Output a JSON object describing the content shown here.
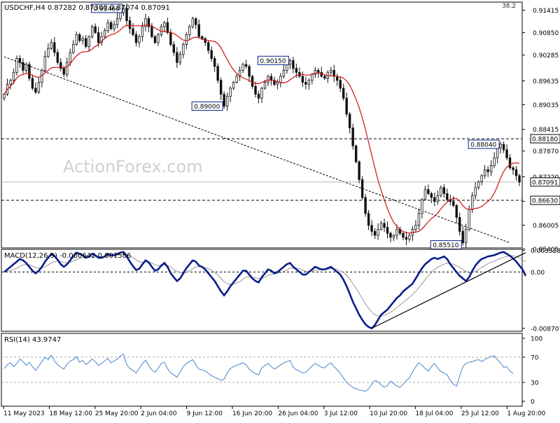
{
  "header": {
    "symbol_line": "USDCHF,H4  0.87282 0.87300 0.87074 0.87091",
    "zoom_value": "38.2"
  },
  "watermark": "ActionForex.com",
  "colors": {
    "candle": "#111111",
    "sma": "#d01010",
    "macd": "#0a1e8c",
    "signal": "#999999",
    "rsi": "#4a86c8",
    "grid": "#c8c8c8",
    "frame": "#000000"
  },
  "chart_data": [
    {
      "type": "candlestick",
      "title": "USDCHF,H4",
      "ohlc_last": {
        "open": 0.87282,
        "high": 0.873,
        "low": 0.87074,
        "close": 0.87091
      },
      "ylim": [
        0.8545,
        0.916
      ],
      "y_ticks": [
        0.91415,
        0.9085,
        0.90285,
        0.89635,
        0.89035,
        0.88415,
        0.8787,
        0.8722,
        0.86605,
        0.86005,
        0.85405
      ],
      "x_tick_labels": [
        "11 May 2023",
        "18 May 12:00",
        "25 May 20:00",
        "2 Jun 04:00",
        "9 Jun 12:00",
        "16 Jun 20:00",
        "26 Jun 04:00",
        "3 Jul 12:00",
        "10 Jul 20:00",
        "18 Jul 04:00",
        "25 Jul 12:00",
        "1 Aug 20:00"
      ],
      "annotations": [
        {
          "text": "0.91460",
          "value": 0.9146
        },
        {
          "text": "0.90150",
          "value": 0.9015
        },
        {
          "text": "0.89000",
          "value": 0.89
        },
        {
          "text": "0.88040",
          "value": 0.8804
        },
        {
          "text": "0.85510",
          "value": 0.8551
        }
      ],
      "levels": [
        {
          "text": "0.88180",
          "value": 0.8818,
          "style": "dashed"
        },
        {
          "text": "0.86630",
          "value": 0.8663,
          "style": "dashed"
        },
        {
          "text": "0.87091",
          "value": 0.87091,
          "style": "current"
        }
      ],
      "trendline_from": {
        "bar": 0,
        "price": 0.9024
      },
      "trendline_to": {
        "bar": 161,
        "price": 0.8556
      },
      "closes": [
        0.893,
        0.8955,
        0.8965,
        0.8985,
        0.902,
        0.901,
        0.899,
        0.9005,
        0.897,
        0.8945,
        0.8935,
        0.896,
        0.899,
        0.9025,
        0.9045,
        0.906,
        0.9035,
        0.901,
        0.8995,
        0.898,
        0.901,
        0.9035,
        0.9055,
        0.908,
        0.9065,
        0.907,
        0.905,
        0.9075,
        0.91,
        0.9085,
        0.906,
        0.9075,
        0.909,
        0.911,
        0.9095,
        0.9105,
        0.912,
        0.9135,
        0.9146,
        0.9115,
        0.9095,
        0.908,
        0.906,
        0.9075,
        0.91,
        0.912,
        0.91,
        0.9075,
        0.906,
        0.908,
        0.91,
        0.911,
        0.9085,
        0.9055,
        0.9035,
        0.901,
        0.903,
        0.9055,
        0.908,
        0.91,
        0.912,
        0.9105,
        0.9075,
        0.907,
        0.906,
        0.904,
        0.902,
        0.9,
        0.8965,
        0.893,
        0.89,
        0.8925,
        0.8945,
        0.896,
        0.8975,
        0.899,
        0.9005,
        0.9,
        0.8975,
        0.895,
        0.893,
        0.892,
        0.8945,
        0.896,
        0.8975,
        0.8965,
        0.8955,
        0.896,
        0.8975,
        0.899,
        0.9005,
        0.9015,
        0.8995,
        0.8985,
        0.8975,
        0.896,
        0.8955,
        0.8965,
        0.898,
        0.899,
        0.8985,
        0.8975,
        0.897,
        0.8985,
        0.899,
        0.8975,
        0.8965,
        0.8945,
        0.892,
        0.888,
        0.8845,
        0.88,
        0.876,
        0.8715,
        0.867,
        0.863,
        0.86,
        0.8585,
        0.8575,
        0.859,
        0.8605,
        0.8595,
        0.858,
        0.857,
        0.8575,
        0.859,
        0.858,
        0.857,
        0.8565,
        0.8575,
        0.859,
        0.86,
        0.863,
        0.8665,
        0.869,
        0.868,
        0.867,
        0.866,
        0.8675,
        0.8695,
        0.868,
        0.8665,
        0.866,
        0.865,
        0.862,
        0.8585,
        0.8556,
        0.859,
        0.864,
        0.8675,
        0.8695,
        0.871,
        0.8725,
        0.874,
        0.8735,
        0.875,
        0.877,
        0.8795,
        0.8804,
        0.879,
        0.877,
        0.8745,
        0.874,
        0.8725,
        0.8709
      ]
    },
    {
      "type": "line",
      "title": "MACD(12,26,9) -0.000642 0.001586",
      "ylim": [
        -0.00905,
        0.0034
      ],
      "y_ticks": [
        0.003328,
        0.0,
        -0.008707
      ],
      "y_tick_labels": [
        "0.003328",
        "0.00",
        "-0.008707"
      ],
      "series": [
        {
          "name": "MACD",
          "values": [
            0.0,
            0.0004,
            0.0008,
            0.0012,
            0.0016,
            0.002,
            0.0018,
            0.0014,
            0.0008,
            0.0002,
            -0.0002,
            0.0002,
            0.0008,
            0.0016,
            0.0022,
            0.0028,
            0.0025,
            0.0019,
            0.0012,
            0.0008,
            0.0012,
            0.0018,
            0.0024,
            0.003,
            0.0028,
            0.0026,
            0.0022,
            0.0024,
            0.0028,
            0.0026,
            0.0022,
            0.0022,
            0.0024,
            0.0028,
            0.0026,
            0.0026,
            0.0028,
            0.003,
            0.0031,
            0.0024,
            0.0016,
            0.0009,
            0.0003,
            0.0005,
            0.0012,
            0.0018,
            0.0015,
            0.0008,
            0.0002,
            0.0004,
            0.001,
            0.0014,
            0.0008,
            -0.0002,
            -0.0008,
            -0.0014,
            -0.001,
            -0.0002,
            0.0006,
            0.0012,
            0.0018,
            0.0016,
            0.001,
            0.0008,
            0.0004,
            -0.0002,
            -0.0008,
            -0.0014,
            -0.0022,
            -0.003,
            -0.0036,
            -0.003,
            -0.0022,
            -0.0016,
            -0.001,
            -0.0004,
            0.0002,
            0.0002,
            -0.0004,
            -0.001,
            -0.0014,
            -0.0016,
            -0.0008,
            -0.0002,
            0.0004,
            0.0002,
            -0.0002,
            0.0,
            0.0004,
            0.0008,
            0.0012,
            0.0014,
            0.0008,
            0.0004,
            0.0,
            -0.0004,
            -0.0004,
            0.0,
            0.0004,
            0.0008,
            0.0006,
            0.0004,
            0.0004,
            0.0006,
            0.0008,
            0.0004,
            0.0,
            -0.0004,
            -0.0012,
            -0.0022,
            -0.0034,
            -0.0046,
            -0.0056,
            -0.0066,
            -0.0074,
            -0.0081,
            -0.0085,
            -0.0087,
            -0.0082,
            -0.0074,
            -0.0066,
            -0.0062,
            -0.0058,
            -0.0052,
            -0.0046,
            -0.004,
            -0.0036,
            -0.003,
            -0.0026,
            -0.0022,
            -0.0018,
            -0.001,
            -0.0002,
            0.0006,
            0.0012,
            0.0016,
            0.002,
            0.0022,
            0.002,
            0.0022,
            0.0024,
            0.002,
            0.0012,
            0.0006,
            0.0,
            -0.0006,
            -0.001,
            -0.0014,
            -0.0008,
            0.0002,
            0.001,
            0.0016,
            0.002,
            0.0022,
            0.0024,
            0.0025,
            0.0026,
            0.0028,
            0.003,
            0.0031,
            0.0028,
            0.0025,
            0.0021,
            0.0016,
            0.001,
            0.0004,
            -0.0006
          ]
        },
        {
          "name": "Signal",
          "values": [
            0.0,
            0.0001,
            0.0002,
            0.0004,
            0.0006,
            0.0009,
            0.0011,
            0.0012,
            0.0011,
            0.0009,
            0.0007,
            0.0006,
            0.0007,
            0.0008,
            0.0011,
            0.0014,
            0.0016,
            0.0017,
            0.0016,
            0.0015,
            0.0014,
            0.0015,
            0.0017,
            0.0019,
            0.0021,
            0.0022,
            0.0022,
            0.0023,
            0.0024,
            0.0024,
            0.0024,
            0.0024,
            0.0024,
            0.0025,
            0.0025,
            0.0025,
            0.0026,
            0.0027,
            0.0027,
            0.0027,
            0.0025,
            0.0022,
            0.0019,
            0.0016,
            0.0015,
            0.0016,
            0.0015,
            0.0014,
            0.0011,
            0.001,
            0.001,
            0.0011,
            0.001,
            0.0008,
            0.0004,
            0.0001,
            -0.0001,
            -0.0002,
            -0.0001,
            0.0002,
            0.0005,
            0.0008,
            0.0008,
            0.0008,
            0.0007,
            0.0005,
            0.0003,
            -0.0001,
            -0.0005,
            -0.001,
            -0.0015,
            -0.0018,
            -0.0019,
            -0.0019,
            -0.0017,
            -0.0015,
            -0.0011,
            -0.0008,
            -0.0007,
            -0.0008,
            -0.0009,
            -0.001,
            -0.001,
            -0.0008,
            -0.0005,
            -0.0004,
            -0.0003,
            -0.0002,
            -0.0001,
            0.0001,
            0.0003,
            0.0006,
            0.0006,
            0.0006,
            0.0005,
            0.0003,
            0.0001,
            0.0001,
            0.0001,
            0.0003,
            0.0003,
            0.0004,
            0.0004,
            0.0004,
            0.0005,
            0.0005,
            0.0004,
            0.0002,
            -0.0001,
            -0.0005,
            -0.0011,
            -0.0018,
            -0.0025,
            -0.0033,
            -0.0041,
            -0.0049,
            -0.0056,
            -0.0062,
            -0.0066,
            -0.0068,
            -0.0068,
            -0.0067,
            -0.0065,
            -0.0062,
            -0.0059,
            -0.0055,
            -0.0051,
            -0.0047,
            -0.0043,
            -0.0039,
            -0.0035,
            -0.003,
            -0.0024,
            -0.0018,
            -0.0012,
            -0.0006,
            -0.0001,
            0.0004,
            0.0007,
            0.001,
            0.0012,
            0.0014,
            0.0013,
            0.0012,
            0.001,
            0.0007,
            0.0004,
            0.0001,
            -0.0001,
            -0.0001,
            0.0001,
            0.0004,
            0.0007,
            0.001,
            0.0013,
            0.0015,
            0.0017,
            0.0019,
            0.0021,
            0.0023,
            0.0024,
            0.0025,
            0.0025,
            0.0024,
            0.0022,
            0.0019,
            0.0016
          ]
        }
      ],
      "trendline_from": {
        "bar": 117,
        "value": -0.0087
      },
      "trendline_to": {
        "bar": 166,
        "value": 0.003
      }
    },
    {
      "type": "line",
      "title": "RSI(14) 43.9747",
      "ylim": [
        0,
        100
      ],
      "y_ticks": [
        100,
        70,
        30,
        0
      ],
      "levels": [
        70,
        30
      ],
      "series": [
        {
          "name": "RSI",
          "values": [
            52,
            58,
            61,
            55,
            60,
            67,
            63,
            57,
            62,
            55,
            49,
            56,
            63,
            70,
            66,
            73,
            64,
            58,
            54,
            51,
            59,
            64,
            66,
            71,
            62,
            65,
            58,
            62,
            67,
            63,
            57,
            60,
            64,
            68,
            61,
            64,
            67,
            72,
            75,
            58,
            52,
            49,
            45,
            52,
            60,
            65,
            56,
            50,
            46,
            52,
            60,
            62,
            52,
            45,
            42,
            38,
            46,
            55,
            60,
            63,
            66,
            58,
            51,
            50,
            48,
            44,
            41,
            38,
            36,
            33,
            35,
            45,
            52,
            55,
            57,
            59,
            61,
            58,
            51,
            47,
            44,
            42,
            53,
            57,
            60,
            55,
            51,
            54,
            58,
            61,
            63,
            65,
            54,
            50,
            48,
            45,
            46,
            51,
            56,
            60,
            57,
            54,
            53,
            58,
            61,
            55,
            50,
            44,
            37,
            30,
            26,
            22,
            20,
            18,
            17,
            16,
            20,
            27,
            33,
            31,
            26,
            22,
            25,
            32,
            28,
            24,
            22,
            27,
            33,
            37,
            47,
            55,
            61,
            57,
            52,
            48,
            55,
            60,
            53,
            47,
            45,
            42,
            33,
            27,
            24,
            40,
            55,
            60,
            62,
            63,
            65,
            66,
            63,
            66,
            69,
            71,
            72,
            66,
            61,
            54,
            55,
            48,
            44
          ]
        }
      ]
    }
  ]
}
